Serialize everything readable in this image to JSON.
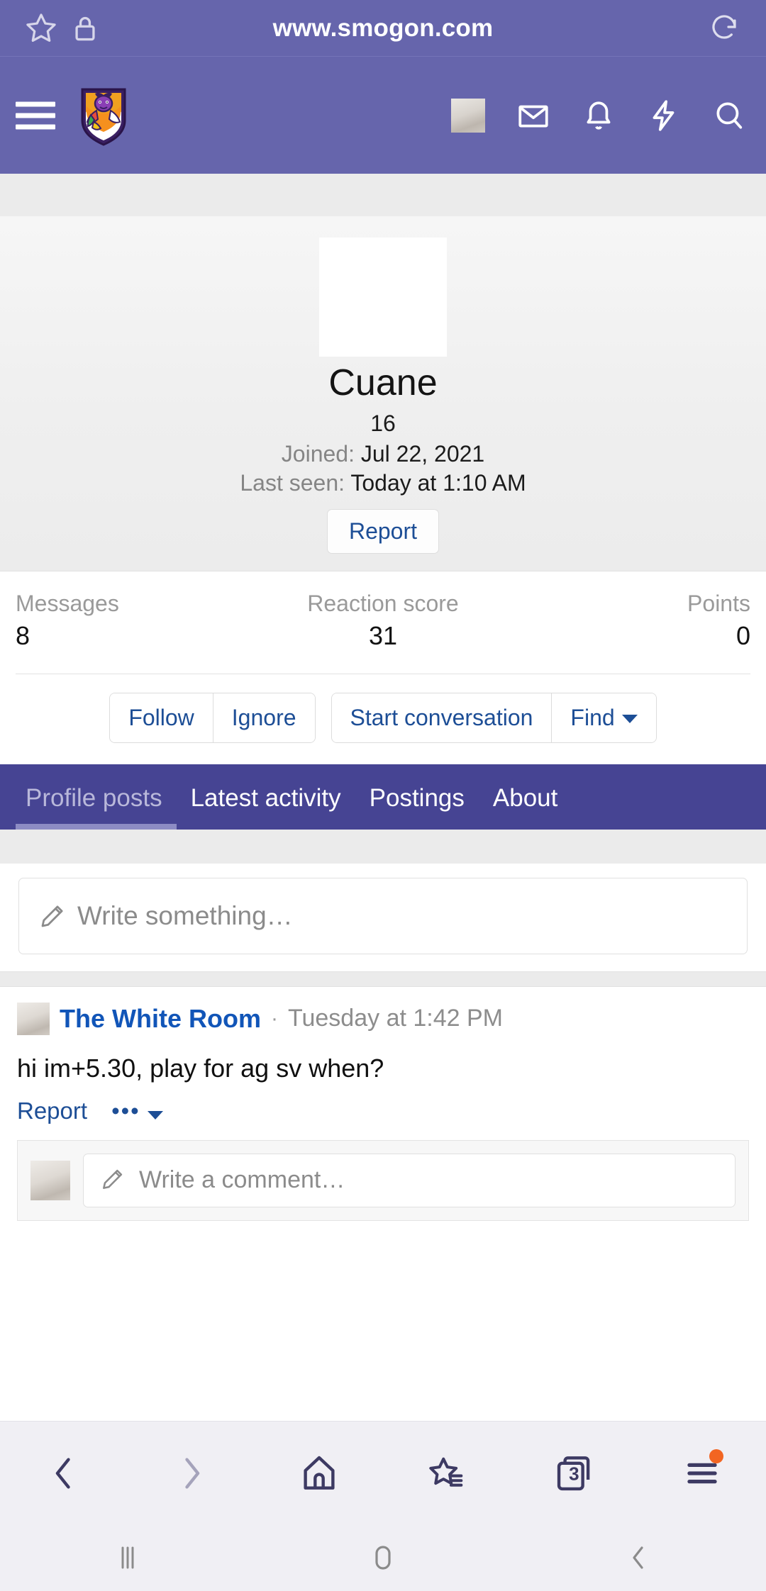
{
  "browser": {
    "url": "www.smogon.com",
    "star_icon": "star-icon",
    "lock_icon": "lock-icon",
    "reload_icon": "reload-icon",
    "toolbar": {
      "back": "back-arrow-icon",
      "forward": "forward-arrow-icon",
      "home": "home-icon",
      "bookmarks": "bookmarks-star-icon",
      "tabs_label": "3",
      "menu": "menu-icon"
    }
  },
  "android_nav": {
    "recents": "recents-icon",
    "home": "home-circle-icon",
    "back": "back-chevron-icon"
  },
  "sitenav": {
    "menu_icon": "hamburger-menu-icon",
    "logo": "smogon-logo",
    "icons": [
      {
        "name": "user-avatar-icon"
      },
      {
        "name": "inbox-envelope-icon"
      },
      {
        "name": "alerts-bell-icon"
      },
      {
        "name": "bolt-icon"
      },
      {
        "name": "search-icon"
      }
    ]
  },
  "profile": {
    "username": "Cuane",
    "age": "16",
    "joined_label": "Joined:",
    "joined_value": "Jul 22, 2021",
    "last_seen_label": "Last seen:",
    "last_seen_value": "Today at 1:10 AM",
    "report_label": "Report",
    "stats": [
      {
        "key": "Messages",
        "value": "8"
      },
      {
        "key": "Reaction score",
        "value": "31"
      },
      {
        "key": "Points",
        "value": "0"
      }
    ],
    "actions_group_one": [
      "Follow",
      "Ignore"
    ],
    "actions_group_two": [
      "Start conversation",
      "Find"
    ],
    "tabs": [
      {
        "label": "Profile posts",
        "active": true
      },
      {
        "label": "Latest activity",
        "active": false
      },
      {
        "label": "Postings",
        "active": false
      },
      {
        "label": "About",
        "active": false
      }
    ]
  },
  "composer": {
    "placeholder": "Write something…",
    "pencil_icon": "pencil-icon"
  },
  "post": {
    "author": "The White Room",
    "separator": "·",
    "timestamp": "Tuesday at 1:42 PM",
    "body": "hi im+5.30, play for ag sv when?",
    "report_label": "Report",
    "more_label": "•••",
    "comment_placeholder": "Write a comment…"
  },
  "colors": {
    "browser_purple": "#6665ac",
    "tabbar_purple": "#464493",
    "tab_active_underline": "#8d8cc4",
    "link_blue": "#1d4e96",
    "author_blue": "#1155b8",
    "page_gray": "#ebebeb",
    "badge_orange": "#f26522"
  }
}
